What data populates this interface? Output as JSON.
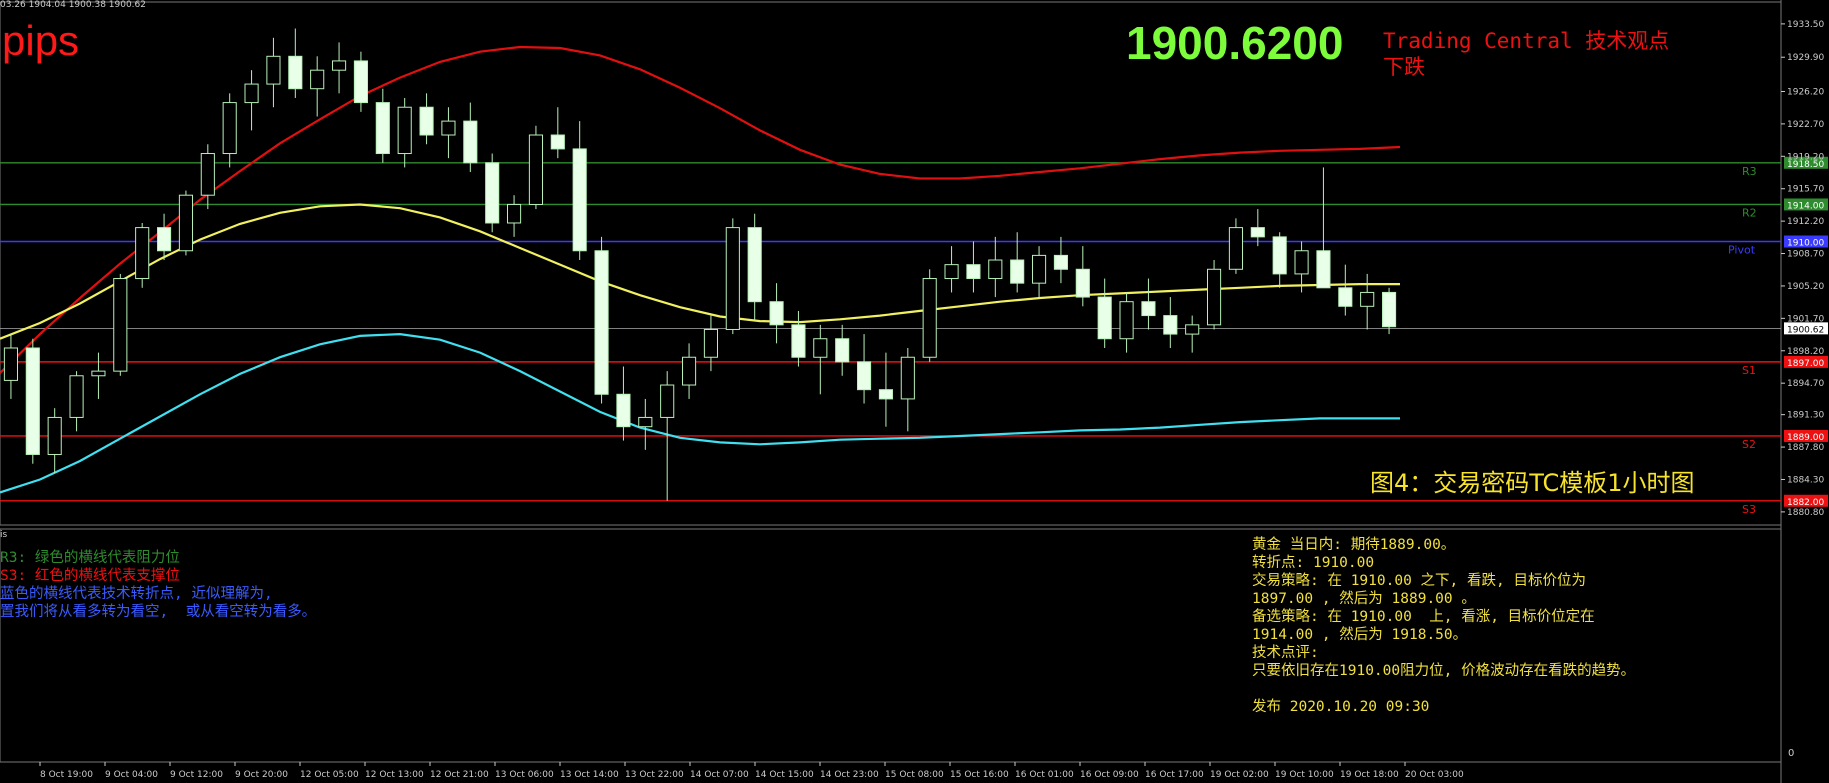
{
  "header": {
    "ohlc": "03.26 1904.04 1900.38 1900.62"
  },
  "overlay": {
    "pips": "pips",
    "price": "1900.6200",
    "tc_title": "Trading Central 技术观点",
    "tc_view": "下跌",
    "figure_caption": "图4：交易密码TC模板1小时图"
  },
  "subwindow": {
    "label": "is"
  },
  "legend": {
    "line1": "R3: 绿色的横线代表阻力位",
    "line2": "S3: 红色的横线代表支撑位",
    "line3": "蓝色的横线代表技术转折点, 近似理解为,",
    "line4": "置我们将从看多转为看空,  或从看空转为看多。"
  },
  "analysis": {
    "line1": "黄金 当日内: 期待1889.00。",
    "line2": "转折点: 1910.00",
    "line3": "交易策略: 在 1910.00 之下, 看跌, 目标价位为",
    "line4": "1897.00 , 然后为 1889.00 。",
    "line5": "备选策略: 在 1910.00  上, 看涨, 目标价位定在",
    "line6": "1914.00 , 然后为 1918.50。",
    "line7": "技术点评:",
    "line8": "只要依旧存在1910.00阻力位, 价格波动存在看跌的趋势。",
    "line9": "",
    "line10": "发布 2020.10.20 09:30"
  },
  "chart_data": {
    "type": "line",
    "title": "",
    "ylim": [
      1879.6,
      1935.0
    ],
    "y_ticks": [
      "1933.50",
      "1929.90",
      "1926.20",
      "1922.70",
      "1919.20",
      "1915.70",
      "1912.20",
      "1908.70",
      "1905.20",
      "1901.70",
      "1898.20",
      "1894.70",
      "1891.30",
      "1887.80",
      "1884.30",
      "1880.80"
    ],
    "x_ticks": [
      "8 Oct 19:00",
      "9 Oct 04:00",
      "9 Oct 12:00",
      "9 Oct 20:00",
      "12 Oct 05:00",
      "12 Oct 13:00",
      "12 Oct 21:00",
      "13 Oct 06:00",
      "13 Oct 14:00",
      "13 Oct 22:00",
      "14 Oct 07:00",
      "14 Oct 15:00",
      "14 Oct 23:00",
      "15 Oct 08:00",
      "15 Oct 16:00",
      "16 Oct 01:00",
      "16 Oct 09:00",
      "16 Oct 17:00",
      "19 Oct 02:00",
      "19 Oct 10:00",
      "19 Oct 18:00",
      "20 Oct 03:00"
    ],
    "levels": [
      {
        "name": "R3",
        "value": 1918.5,
        "label": "1918.50",
        "color": "#2e8b2e"
      },
      {
        "name": "R2",
        "value": 1914.0,
        "label": "1914.00",
        "color": "#2e8b2e"
      },
      {
        "name": "Pivot",
        "value": 1910.0,
        "label": "1910.00",
        "color": "#3b3bff"
      },
      {
        "name": "S1",
        "value": 1897.0,
        "label": "1897.00",
        "color": "#e11"
      },
      {
        "name": "S2",
        "value": 1889.0,
        "label": "1889.00",
        "color": "#e11"
      },
      {
        "name": "S3",
        "value": 1882.0,
        "label": "1882.00",
        "color": "#e11"
      }
    ],
    "last_price": {
      "value": 1900.62,
      "label": "1900.62"
    },
    "upper_band": [
      1895.8,
      1900.0,
      1903.9,
      1907.6,
      1911.0,
      1914.5,
      1917.6,
      1920.6,
      1923.2,
      1925.7,
      1927.7,
      1929.4,
      1930.5,
      1931.0,
      1930.9,
      1930.1,
      1928.6,
      1926.6,
      1924.4,
      1922.0,
      1919.9,
      1918.3,
      1917.3,
      1916.8,
      1916.8,
      1917.1,
      1917.5,
      1917.9,
      1918.4,
      1918.9,
      1919.3,
      1919.6,
      1919.8,
      1919.9,
      1920.0,
      1920.2
    ],
    "middle_ma": [
      1899.5,
      1901.2,
      1903.3,
      1905.7,
      1908.1,
      1910.2,
      1911.9,
      1913.1,
      1913.8,
      1914.0,
      1913.6,
      1912.6,
      1911.1,
      1909.3,
      1907.5,
      1905.7,
      1904.2,
      1902.9,
      1901.9,
      1901.4,
      1901.3,
      1901.6,
      1902.0,
      1902.5,
      1903.0,
      1903.5,
      1903.9,
      1904.2,
      1904.4,
      1904.6,
      1904.8,
      1905.0,
      1905.2,
      1905.3,
      1905.4,
      1905.4
    ],
    "lower_band": [
      1882.9,
      1884.3,
      1886.3,
      1888.7,
      1891.1,
      1893.5,
      1895.7,
      1897.5,
      1898.9,
      1899.8,
      1900.0,
      1899.4,
      1898.0,
      1896.0,
      1893.8,
      1891.6,
      1889.9,
      1888.8,
      1888.3,
      1888.1,
      1888.3,
      1888.6,
      1888.7,
      1888.8,
      1889.0,
      1889.2,
      1889.4,
      1889.6,
      1889.7,
      1889.9,
      1890.2,
      1890.5,
      1890.7,
      1890.9,
      1890.9,
      1890.9
    ],
    "candles": [
      [
        1895.0,
        1900.0,
        1893.0,
        1898.5
      ],
      [
        1898.5,
        1899.5,
        1886.0,
        1887.0
      ],
      [
        1887.0,
        1892.0,
        1885.0,
        1891.0
      ],
      [
        1891.0,
        1896.0,
        1889.5,
        1895.5
      ],
      [
        1895.5,
        1898.0,
        1893.0,
        1896.0
      ],
      [
        1896.0,
        1906.5,
        1895.5,
        1906.0
      ],
      [
        1906.0,
        1912.0,
        1905.0,
        1911.5
      ],
      [
        1911.5,
        1913.0,
        1908.0,
        1909.0
      ],
      [
        1909.0,
        1915.5,
        1908.5,
        1915.0
      ],
      [
        1915.0,
        1920.5,
        1913.5,
        1919.5
      ],
      [
        1919.5,
        1926.0,
        1918.0,
        1925.0
      ],
      [
        1925.0,
        1928.5,
        1922.0,
        1927.0
      ],
      [
        1927.0,
        1932.0,
        1924.5,
        1930.0
      ],
      [
        1930.0,
        1933.0,
        1925.5,
        1926.5
      ],
      [
        1926.5,
        1930.0,
        1923.5,
        1928.5
      ],
      [
        1928.5,
        1931.5,
        1926.0,
        1929.5
      ],
      [
        1929.5,
        1930.5,
        1924.0,
        1925.0
      ],
      [
        1925.0,
        1926.5,
        1918.5,
        1919.5
      ],
      [
        1919.5,
        1925.5,
        1918.0,
        1924.5
      ],
      [
        1924.5,
        1926.0,
        1920.5,
        1921.5
      ],
      [
        1921.5,
        1924.5,
        1919.0,
        1923.0
      ],
      [
        1923.0,
        1925.0,
        1917.5,
        1918.5
      ],
      [
        1918.5,
        1919.5,
        1911.0,
        1912.0
      ],
      [
        1912.0,
        1915.0,
        1910.5,
        1914.0
      ],
      [
        1914.0,
        1922.5,
        1913.5,
        1921.5
      ],
      [
        1921.5,
        1924.5,
        1919.0,
        1920.0
      ],
      [
        1920.0,
        1923.0,
        1908.0,
        1909.0
      ],
      [
        1909.0,
        1910.5,
        1892.5,
        1893.5
      ],
      [
        1893.5,
        1896.5,
        1888.5,
        1890.0
      ],
      [
        1890.0,
        1893.0,
        1887.5,
        1891.0
      ],
      [
        1891.0,
        1896.0,
        1882.0,
        1894.5
      ],
      [
        1894.5,
        1899.0,
        1893.0,
        1897.5
      ],
      [
        1897.5,
        1902.0,
        1896.0,
        1900.5
      ],
      [
        1900.5,
        1912.5,
        1900.0,
        1911.5
      ],
      [
        1911.5,
        1913.0,
        1901.5,
        1903.5
      ],
      [
        1903.5,
        1905.5,
        1899.0,
        1901.0
      ],
      [
        1901.0,
        1902.5,
        1896.5,
        1897.5
      ],
      [
        1897.5,
        1901.0,
        1893.5,
        1899.5
      ],
      [
        1899.5,
        1901.0,
        1895.5,
        1897.0
      ],
      [
        1897.0,
        1900.0,
        1892.5,
        1894.0
      ],
      [
        1894.0,
        1898.0,
        1890.0,
        1893.0
      ],
      [
        1893.0,
        1898.5,
        1889.5,
        1897.5
      ],
      [
        1897.5,
        1907.0,
        1897.0,
        1906.0
      ],
      [
        1906.0,
        1909.5,
        1904.5,
        1907.5
      ],
      [
        1907.5,
        1910.0,
        1904.5,
        1906.0
      ],
      [
        1906.0,
        1910.5,
        1904.0,
        1908.0
      ],
      [
        1908.0,
        1911.0,
        1904.5,
        1905.5
      ],
      [
        1905.5,
        1909.5,
        1904.0,
        1908.5
      ],
      [
        1908.5,
        1910.5,
        1905.5,
        1907.0
      ],
      [
        1907.0,
        1909.5,
        1903.0,
        1904.0
      ],
      [
        1904.0,
        1906.0,
        1898.5,
        1899.5
      ],
      [
        1899.5,
        1904.5,
        1898.0,
        1903.5
      ],
      [
        1903.5,
        1906.0,
        1900.5,
        1902.0
      ],
      [
        1902.0,
        1904.0,
        1898.5,
        1900.0
      ],
      [
        1900.0,
        1902.0,
        1898.0,
        1901.0
      ],
      [
        1901.0,
        1908.0,
        1900.5,
        1907.0
      ],
      [
        1907.0,
        1912.5,
        1906.5,
        1911.5
      ],
      [
        1911.5,
        1913.5,
        1909.5,
        1910.5
      ],
      [
        1910.5,
        1911.0,
        1905.0,
        1906.5
      ],
      [
        1906.5,
        1910.0,
        1904.5,
        1909.0
      ],
      [
        1909.0,
        1918.0,
        1908.0,
        1905.0
      ],
      [
        1905.0,
        1907.5,
        1902.0,
        1903.0
      ],
      [
        1903.0,
        1906.5,
        1900.5,
        1904.5
      ],
      [
        1904.5,
        1905.0,
        1900.0,
        1900.8
      ]
    ]
  }
}
